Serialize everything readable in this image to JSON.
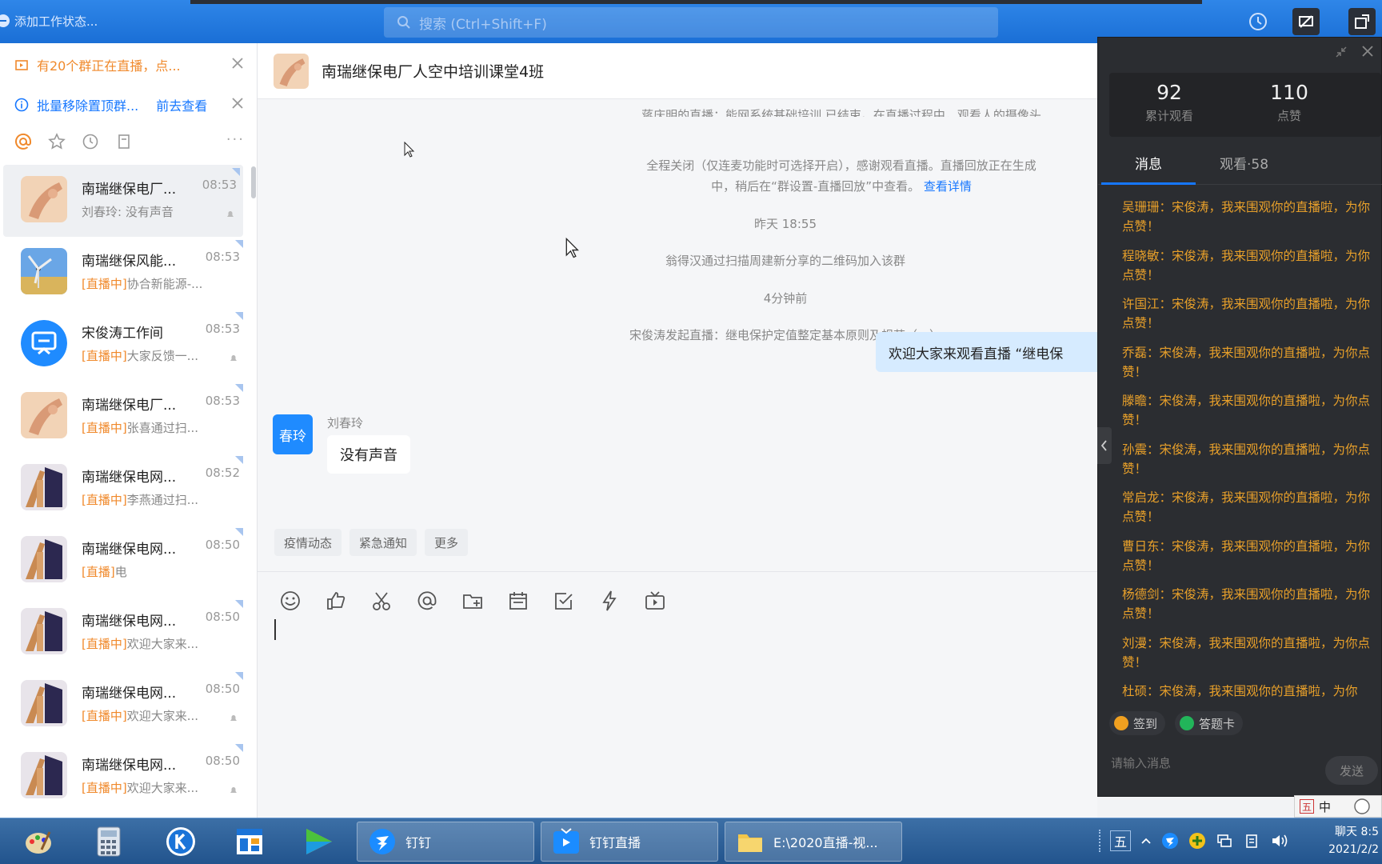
{
  "topbar": {
    "status_label": "添加工作状态...",
    "search_placeholder": "搜索 (Ctrl+Shift+F)"
  },
  "sidebar": {
    "notice_live": "有20个群正在直播，点...",
    "notice_batch": "批量移除置顶群...",
    "notice_batch_link": "前去查看",
    "conversations": [
      {
        "name": "南瑞继保电厂...",
        "time": "08:53",
        "tag": "",
        "preview": "刘春玲: 没有声音"
      },
      {
        "name": "南瑞继保风能...",
        "time": "08:53",
        "tag": "[直播中]",
        "preview": "协合新能源-..."
      },
      {
        "name": "宋俊涛工作间",
        "time": "08:53",
        "tag": "[直播中]",
        "preview": "大家反馈一..."
      },
      {
        "name": "南瑞继保电厂...",
        "time": "08:53",
        "tag": "[直播中]",
        "preview": "张喜通过扫..."
      },
      {
        "name": "南瑞继保电网...",
        "time": "08:52",
        "tag": "[直播中]",
        "preview": "李燕通过扫..."
      },
      {
        "name": "南瑞继保电网...",
        "time": "08:50",
        "tag": "[直播]",
        "preview": "电"
      },
      {
        "name": "南瑞继保电网...",
        "time": "08:50",
        "tag": "[直播中]",
        "preview": "欢迎大家来..."
      },
      {
        "name": "南瑞继保电网...",
        "time": "08:50",
        "tag": "[直播中]",
        "preview": "欢迎大家来..."
      },
      {
        "name": "南瑞继保电网...",
        "time": "08:50",
        "tag": "[直播中]",
        "preview": "欢迎大家来..."
      }
    ]
  },
  "chat": {
    "title": "南瑞继保电厂人空中培训课堂4班",
    "sys_top_1": "蒋庆明的直播：能网系统基础培训 已结束。在直播过程中，观看人的摄像头",
    "sys_top_2": "全程关闭（仅连麦功能时可选择开启），感谢观看直播。直播回放正在生成",
    "sys_top_3": "中，稍后在“群设置-直播回放”中查看。",
    "sys_top_link": "查看详情",
    "time_yesterday": "昨天 18:55",
    "sys_join": "翁得汉通过扫描周建新分享的二维码加入该群",
    "time_recent": "4分钟前",
    "sys_live_start": "宋俊涛发起直播：继电保护定值整定基本原则及规范（一）",
    "my_message": "欢迎大家来观看直播 “继电保",
    "peer_avatar_text": "春玲",
    "peer_name": "刘春玲",
    "peer_message": "没有声音",
    "quick_tabs": [
      "疫情动态",
      "紧急通知",
      "更多"
    ]
  },
  "live": {
    "total_views": "92",
    "total_views_label": "累计观看",
    "likes": "110",
    "likes_label": "点赞",
    "tab_messages": "消息",
    "tab_viewers": "观看·58",
    "messages": [
      "吴珊珊：宋俊涛，我来围观你的直播啦，为你点赞！",
      "程晓敏：宋俊涛，我来围观你的直播啦，为你点赞！",
      "许国江：宋俊涛，我来围观你的直播啦，为你点赞！",
      "乔磊：宋俊涛，我来围观你的直播啦，为你点赞！",
      "滕瞻：宋俊涛，我来围观你的直播啦，为你点赞！",
      "孙震：宋俊涛，我来围观你的直播啦，为你点赞！",
      "常启龙：宋俊涛，我来围观你的直播啦，为你点赞！",
      "曹日东：宋俊涛，我来围观你的直播啦，为你点赞！",
      "杨德剑：宋俊涛，我来围观你的直播啦，为你点赞！",
      "刘漫：宋俊涛，我来围观你的直播啦，为你点赞！",
      "杜硕：宋俊涛，我来围观你的直播啦，为你"
    ],
    "action_signin": "签到",
    "action_quiz": "答题卡",
    "input_placeholder": "请输入消息",
    "send_label": "发送"
  },
  "ime": {
    "mode_box": "五",
    "mode_text": "中"
  },
  "taskbar": {
    "task_dingtalk": "钉钉",
    "task_live": "钉钉直播",
    "task_folder": "E:\\2020直播-视...",
    "tray_ime": "五",
    "clock_top": "聊天 8:5",
    "clock_date": "2021/2/2"
  },
  "colors": {
    "titlebar": "#1a6fd6",
    "accent": "#1677ff",
    "live_tag": "#f0892b",
    "danmaku": "#e8a02a",
    "live_panel": "#2b2d31"
  }
}
